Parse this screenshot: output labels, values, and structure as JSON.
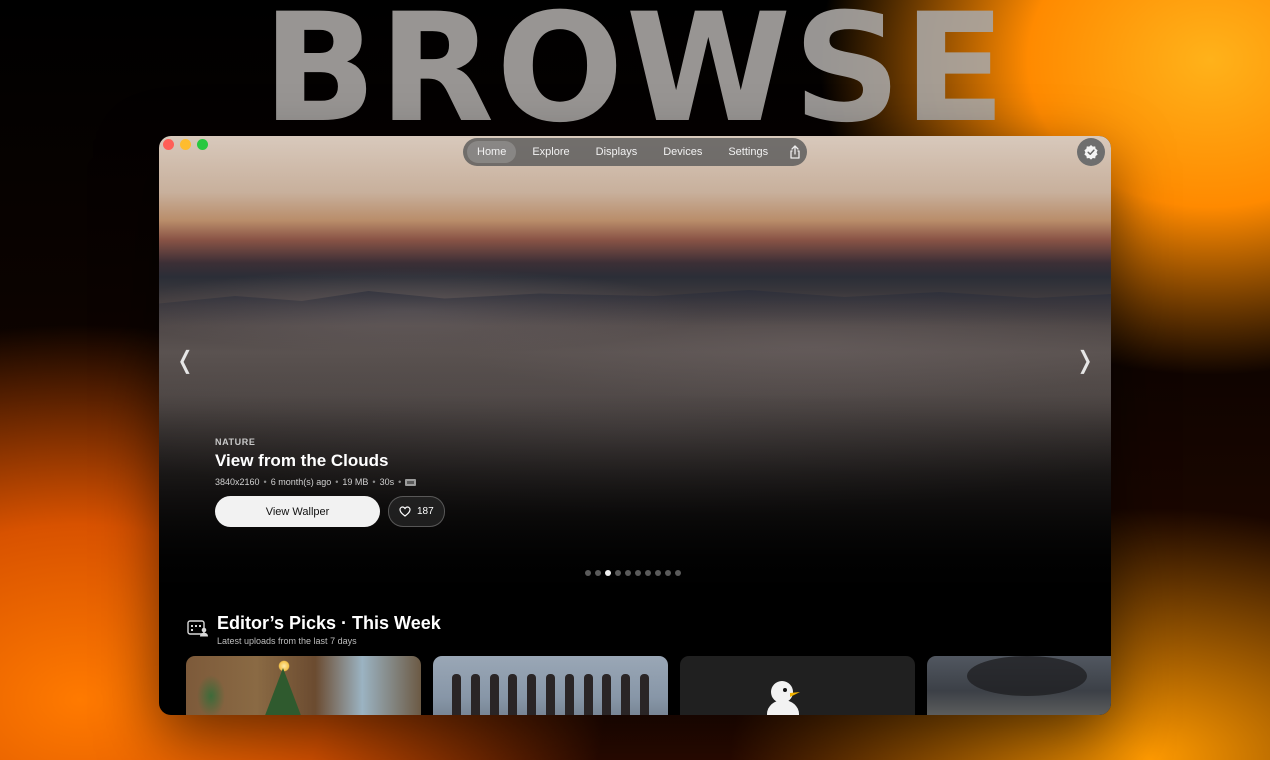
{
  "backdrop": {
    "title": "BROWSE"
  },
  "nav": {
    "items": [
      {
        "label": "Home",
        "active": true
      },
      {
        "label": "Explore"
      },
      {
        "label": "Displays"
      },
      {
        "label": "Devices"
      },
      {
        "label": "Settings"
      }
    ],
    "share_icon": "share-icon"
  },
  "profile": {
    "icon": "verified-badge-icon"
  },
  "hero": {
    "category": "NATURE",
    "title": "View from the Clouds",
    "meta": {
      "resolution": "3840x2160",
      "age": "6 month(s) ago",
      "size": "19 MB",
      "duration": "30s",
      "separator": "•",
      "badge_icon": "resolution-badge-icon"
    },
    "view_button": "View Wallper",
    "likes": "187",
    "slide_count": 10,
    "active_slide": 3
  },
  "section": {
    "title": "Editor’s Picks · This Week",
    "subtitle": "Latest uploads from the last 7 days",
    "icon": "calendar-user-icon"
  },
  "cards": [
    {
      "name": "christmas-room"
    },
    {
      "name": "dancers"
    },
    {
      "name": "duck-character"
    },
    {
      "name": "smoke-battle"
    }
  ],
  "colors": {
    "accent": "#ff8a00",
    "traffic_red": "#ff5f57",
    "traffic_yellow": "#febc2e",
    "traffic_green": "#28c840"
  }
}
